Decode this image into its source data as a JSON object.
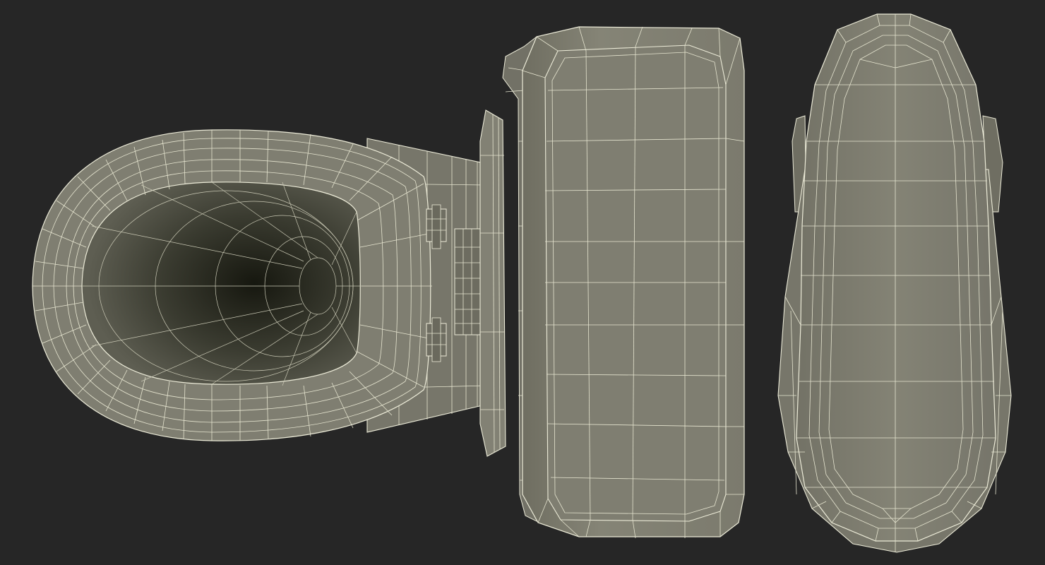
{
  "scene": {
    "background": "#262626",
    "surface_color": "#7d7c6f",
    "wire_color": "#ecebd8",
    "views": [
      {
        "id": "top-view-open",
        "description_name": "toilet-top-view-seat-lifted"
      },
      {
        "id": "back-view",
        "description_name": "toilet-rear-view"
      },
      {
        "id": "top-view-closed",
        "description_name": "toilet-top-view-lid-closed"
      }
    ]
  }
}
